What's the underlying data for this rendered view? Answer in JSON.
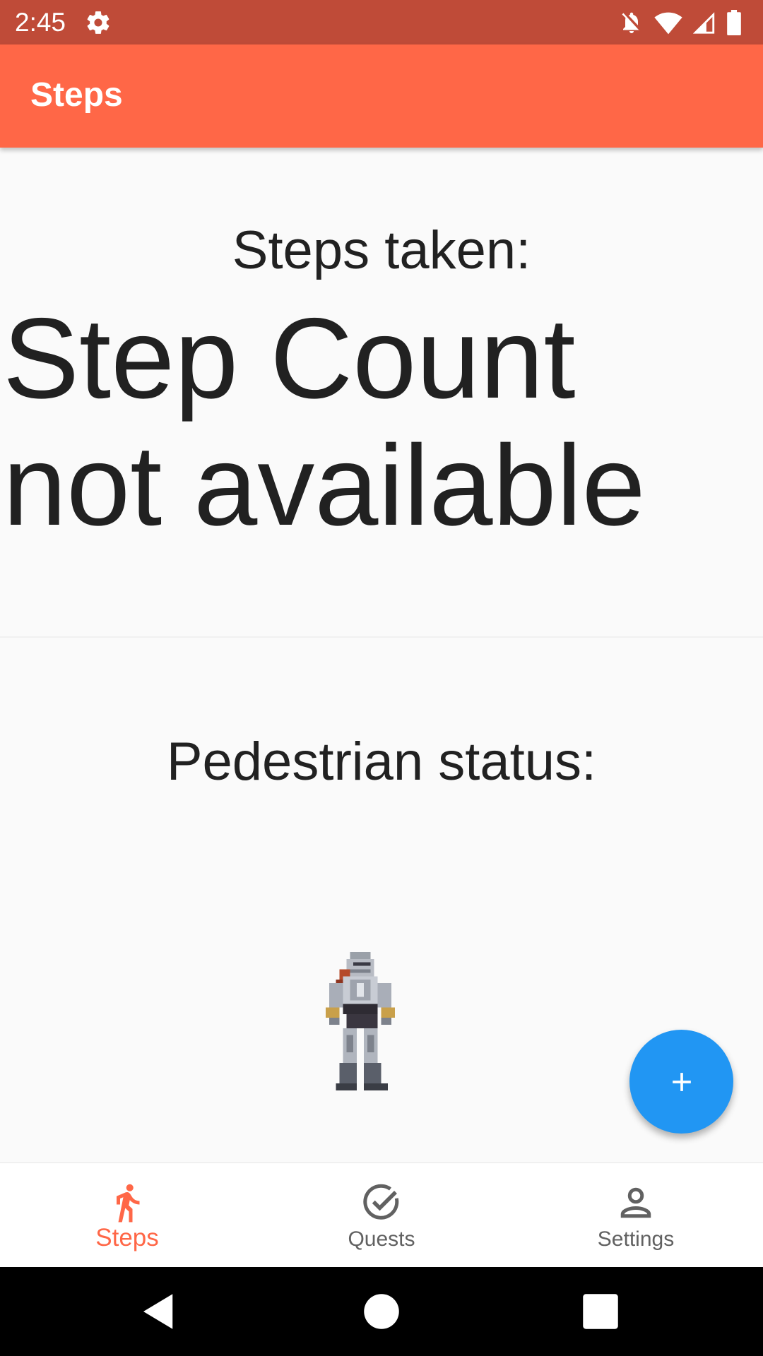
{
  "status_bar": {
    "time": "2:45",
    "icons": [
      "settings-gear-icon",
      "notifications-off-icon",
      "wifi-icon",
      "signal-icon",
      "battery-icon"
    ],
    "color": "#bf4b38"
  },
  "app_bar": {
    "title": "Steps",
    "color": "#ff6747"
  },
  "main": {
    "steps_label": "Steps taken:",
    "steps_value": "Step Count not available",
    "pedestrian_label": "Pedestrian status:",
    "status_image": "knight-sprite"
  },
  "fab": {
    "icon": "plus-icon",
    "color": "#2196f3"
  },
  "bottom_nav": {
    "items": [
      {
        "label": "Steps",
        "icon": "walking-person-icon",
        "active": true
      },
      {
        "label": "Quests",
        "icon": "check-circle-icon",
        "active": false
      },
      {
        "label": "Settings",
        "icon": "person-icon",
        "active": false
      }
    ],
    "active_color": "#ff6747",
    "inactive_color": "#616161"
  },
  "system_nav": {
    "buttons": [
      "back-icon",
      "home-icon",
      "recents-icon"
    ]
  }
}
